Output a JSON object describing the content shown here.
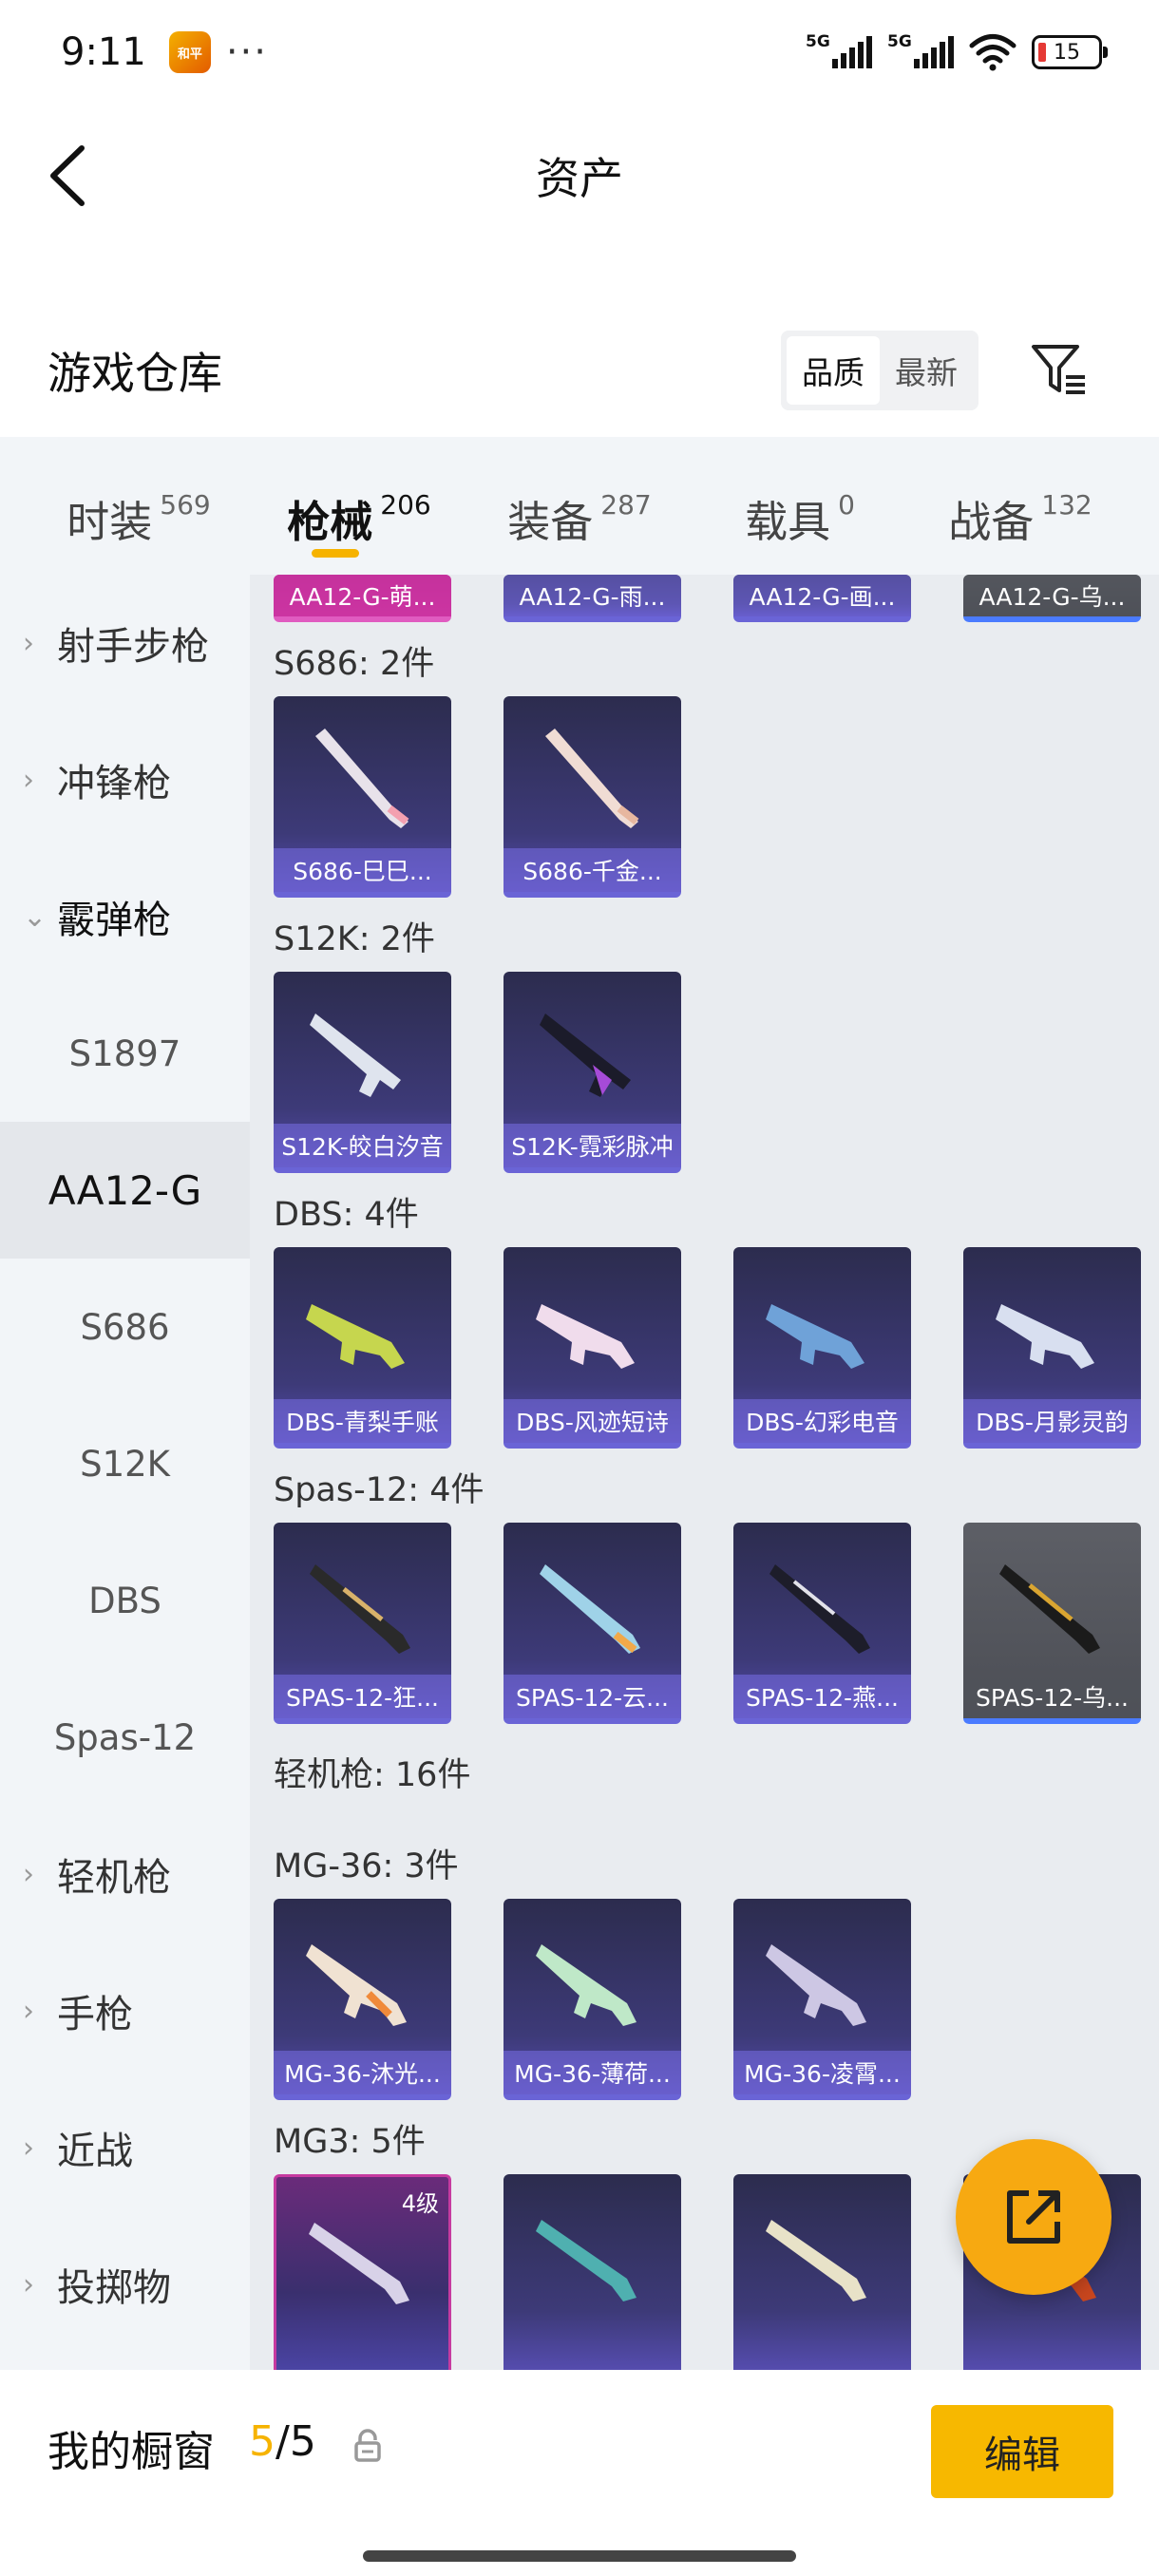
{
  "status_bar": {
    "time": "9:11",
    "app_icon_text": "和平",
    "more": "···",
    "signal1": "5G",
    "signal2": "5G",
    "battery": "15"
  },
  "nav": {
    "title": "资产",
    "back_icon": "chevron-left-icon"
  },
  "section": {
    "title": "游戏仓库",
    "sort_options": [
      "品质",
      "最新"
    ],
    "active_sort": "品质",
    "filter_icon": "filter-icon"
  },
  "category_tabs": [
    {
      "label": "时装",
      "count": "569"
    },
    {
      "label": "枪械",
      "count": "206",
      "active": true
    },
    {
      "label": "装备",
      "count": "287"
    },
    {
      "label": "载具",
      "count": "0"
    },
    {
      "label": "战备",
      "count": "132"
    }
  ],
  "sidebar": {
    "items": [
      {
        "label": "射手步枪",
        "chev": "›"
      },
      {
        "label": "冲锋枪",
        "chev": "›"
      },
      {
        "label": "霰弹枪",
        "chev": "⌄"
      }
    ],
    "sub_items": [
      "S1897",
      "AA12-G",
      "S686",
      "S12K",
      "DBS",
      "Spas-12"
    ],
    "active_sub": "AA12-G",
    "items_after": [
      {
        "label": "轻机枪",
        "chev": "›"
      },
      {
        "label": "手枪",
        "chev": "›"
      },
      {
        "label": "近战",
        "chev": "›"
      },
      {
        "label": "投掷物",
        "chev": "›"
      }
    ]
  },
  "content": {
    "top_partial_row": [
      "AA12-G-萌...",
      "AA12-G-雨...",
      "AA12-G-画...",
      "AA12-G-乌..."
    ],
    "groups": [
      {
        "label": "S686: 2件",
        "items": [
          "S686-巳巳...",
          "S686-千金..."
        ]
      },
      {
        "label": "S12K: 2件",
        "items": [
          "S12K-皎白汐音",
          "S12K-霓彩脉冲"
        ]
      },
      {
        "label": "DBS: 4件",
        "items": [
          "DBS-青梨手账",
          "DBS-风迹短诗",
          "DBS-幻彩电音",
          "DBS-月影灵韵"
        ]
      },
      {
        "label": "Spas-12: 4件",
        "items": [
          "SPAS-12-狂...",
          "SPAS-12-云...",
          "SPAS-12-燕...",
          "SPAS-12-乌..."
        ]
      },
      {
        "label": "轻机枪: 16件"
      },
      {
        "label": "MG-36: 3件",
        "items": [
          "MG-36-沐光...",
          "MG-36-薄荷...",
          "MG-36-凌霄..."
        ]
      },
      {
        "label": "MG3: 5件",
        "level_badge": "4级"
      }
    ]
  },
  "fab": {
    "icon": "share-external-icon"
  },
  "bottom": {
    "title": "我的橱窗",
    "count_current": "5",
    "count_sep": "/",
    "count_total": "5",
    "lock_icon": "lock-icon",
    "edit_label": "编辑"
  }
}
